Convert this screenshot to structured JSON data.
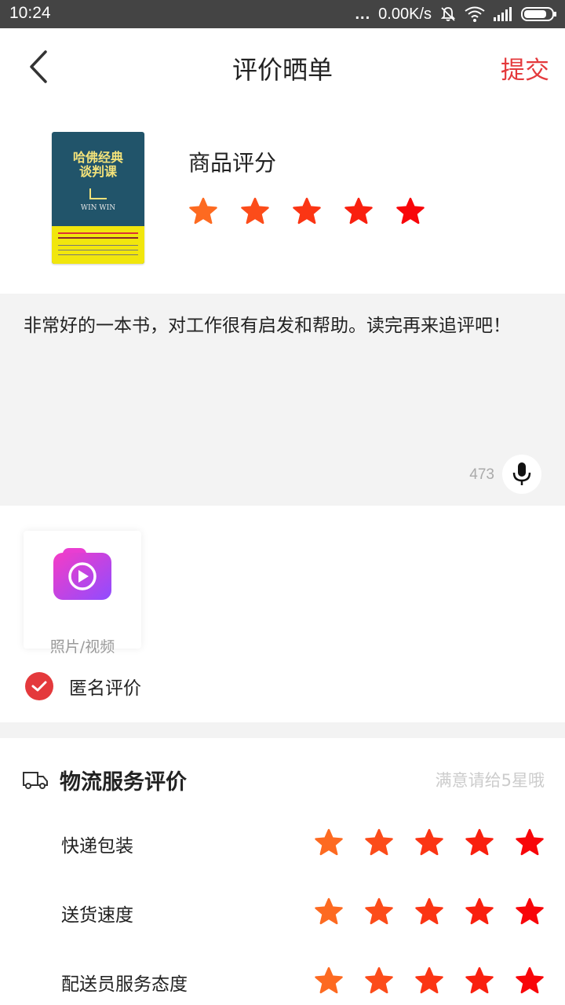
{
  "status_bar": {
    "time": "10:24",
    "dots": "...",
    "network_speed": "0.00K/s"
  },
  "header": {
    "title": "评价晒单",
    "submit_label": "提交"
  },
  "product": {
    "cover_title": "哈佛经典\n谈判课",
    "cover_subtitle": "WIN WIN",
    "rating_label": "商品评分",
    "rating": 5
  },
  "review": {
    "text": "非常好的一本书，对工作很有启发和帮助。读完再来追评吧！",
    "char_count": "473"
  },
  "media": {
    "upload_label": "照片/视频"
  },
  "anonymous": {
    "label": "匿名评价",
    "checked": true
  },
  "logistics": {
    "title": "物流服务评价",
    "hint": "满意请给5星哦",
    "items": [
      {
        "label": "快递包装",
        "rating": 5
      },
      {
        "label": "送货速度",
        "rating": 5
      },
      {
        "label": "配送员服务态度",
        "rating": 5
      }
    ]
  },
  "colors": {
    "accent": "#e4393c",
    "star_gradient": [
      "#fd6a21",
      "#fc4c1a",
      "#fb3514",
      "#f9200f",
      "#f8060a"
    ],
    "review_bg": "#f3f3f3"
  },
  "icons": [
    "back-icon",
    "mic-icon",
    "camera-icon",
    "check-icon",
    "truck-icon",
    "star-icon"
  ]
}
